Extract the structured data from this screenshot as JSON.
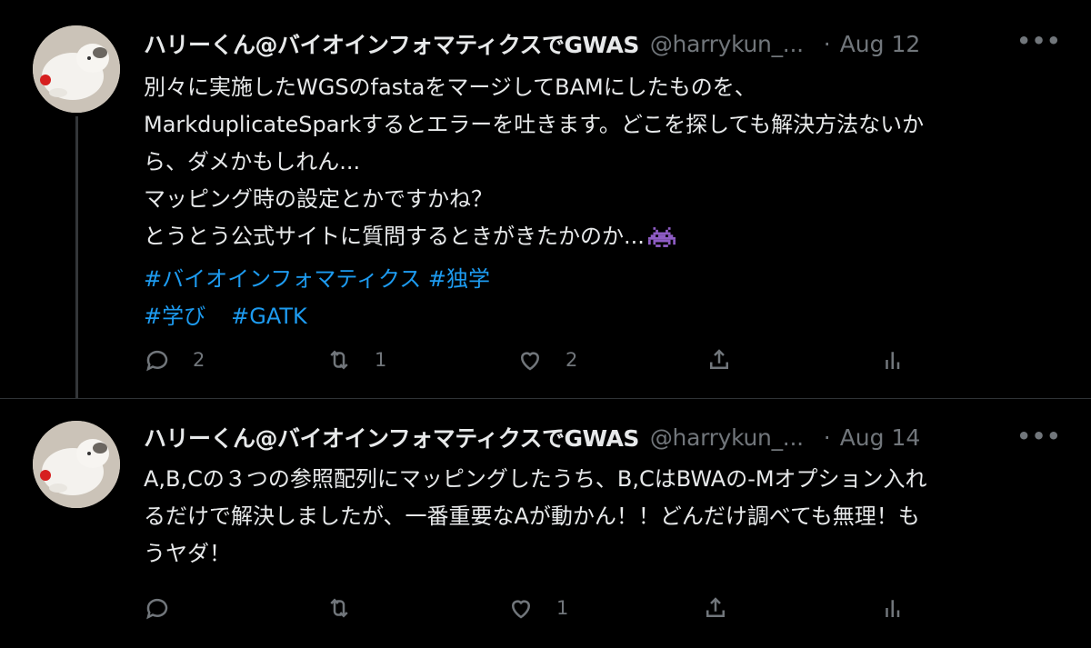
{
  "colors": {
    "background": "#000000",
    "text": "#e7e9ea",
    "secondary": "#71767b",
    "hashtag": "#1d9bf0",
    "thread_line": "#333639"
  },
  "tweets": [
    {
      "name": "ハリーくん@バイオインフォマティクスでGWAS",
      "handle": "@harrykun_...",
      "dot": "·",
      "date": "Aug 12",
      "more": "•••",
      "lines": [
        "別々に実施したWGSのfastaをマージしてBAMにしたものを、",
        "MarkduplicateSparkするとエラーを吐きます。どこを探しても解決方法ないか",
        "ら、ダメかもしれん...",
        "マッピング時の設定とかですかね？",
        "とうとう公式サイトに質問するときがきたかのか..."
      ],
      "emoji": "space-invader-icon",
      "hashtags_line1": [
        "#バイオインフォマティクス",
        "#独学"
      ],
      "hashtags_line2": [
        "#学び",
        "#GATK"
      ],
      "reply_count": "2",
      "retweet_count": "1",
      "like_count": "2"
    },
    {
      "name": "ハリーくん@バイオインフォマティクスでGWAS",
      "handle": "@harrykun_...",
      "dot": "·",
      "date": "Aug 14",
      "more": "•••",
      "lines": [
        "A,B,Cの３つの参照配列にマッピングしたうち、B,CはBWAの-Mオプション入れ",
        "るだけで解決しましたが、一番重要なAが動かん！！どんだけ調べても無理！も",
        "うヤダ！"
      ],
      "reply_count": "",
      "retweet_count": "",
      "like_count": "1"
    }
  ]
}
